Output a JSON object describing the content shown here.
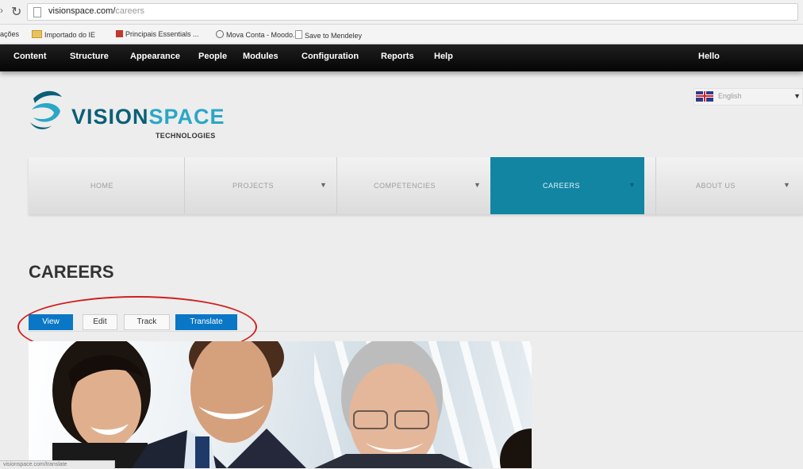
{
  "browser": {
    "url_domain": "visionspace.com/",
    "url_path": "careers",
    "bookmarks": [
      "ações",
      "Importado do IE",
      "Principais Essentials ...",
      "Mova Conta - Moodo...",
      "Save to Mendeley"
    ],
    "status_text": "visionspace.com/translate"
  },
  "toolbar": {
    "items": [
      "Content",
      "Structure",
      "Appearance",
      "People",
      "Modules",
      "Configuration",
      "Reports",
      "Help"
    ],
    "greeting": "Hello"
  },
  "site": {
    "brand_vision": "VISION",
    "brand_space": "SPACE",
    "tagline": "TECHNOLOGIES",
    "language": "English",
    "nav": [
      {
        "label": "HOME"
      },
      {
        "label": "PROJECTS"
      },
      {
        "label": "COMPETENCIES"
      },
      {
        "label": "CAREERS"
      },
      {
        "label": "ABOUT US"
      }
    ]
  },
  "page": {
    "title": "CAREERS",
    "tabs": {
      "view": "View",
      "edit": "Edit",
      "track": "Track",
      "translate": "Translate"
    }
  },
  "colors": {
    "active_nav": "#1285a3",
    "tab_blue": "#0a77c6",
    "highlight_ellipse": "#d02020",
    "brand_dark": "#0a5f77",
    "brand_light": "#2aa7c6"
  }
}
